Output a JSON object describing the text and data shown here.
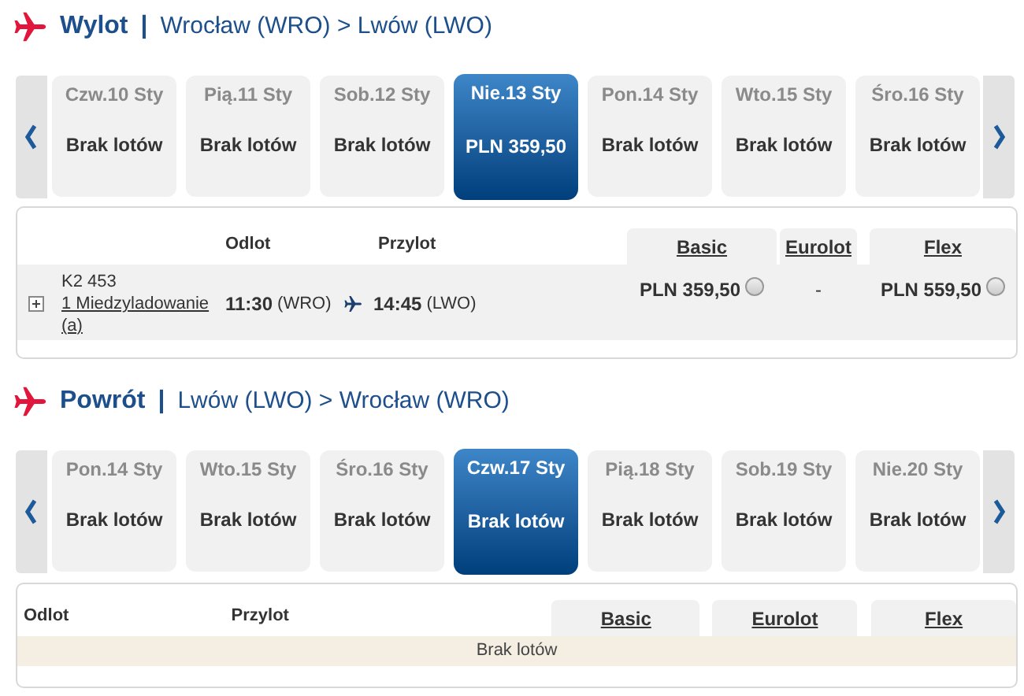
{
  "sections": [
    {
      "title": "Wylot",
      "separator": "|",
      "route": "Wrocław (WRO) > Lwów (LWO)",
      "dates": [
        {
          "day": "Czw.10 Sty",
          "fare": "Brak lotów",
          "selected": false
        },
        {
          "day": "Pią.11 Sty",
          "fare": "Brak lotów",
          "selected": false
        },
        {
          "day": "Sob.12 Sty",
          "fare": "Brak lotów",
          "selected": false
        },
        {
          "day": "Nie.13 Sty",
          "fare": "PLN 359,50",
          "selected": true
        },
        {
          "day": "Pon.14 Sty",
          "fare": "Brak lotów",
          "selected": false
        },
        {
          "day": "Wto.15 Sty",
          "fare": "Brak lotów",
          "selected": false
        },
        {
          "day": "Śro.16 Sty",
          "fare": "Brak lotów",
          "selected": false
        }
      ],
      "results": {
        "columns": [
          "Odlot",
          "Przylot"
        ],
        "fare_classes": [
          "Basic",
          "Eurolot",
          "Flex"
        ],
        "flights": [
          {
            "number": "K2 453",
            "stops": "1 Miedzyladowanie",
            "note": "(a)",
            "departure_time": "11:30",
            "departure_airport": "(WRO)",
            "arrival_time": "14:45",
            "arrival_airport": "(LWO)",
            "fares": [
              {
                "kind": "radio",
                "price": "PLN 359,50",
                "selected": false
              },
              {
                "kind": "none",
                "price": "-"
              },
              {
                "kind": "radio",
                "price": "PLN 559,50",
                "selected": false
              }
            ]
          }
        ]
      }
    },
    {
      "title": "Powrót",
      "separator": "|",
      "route": "Lwów (LWO) > Wrocław (WRO)",
      "dates": [
        {
          "day": "Pon.14 Sty",
          "fare": "Brak lotów",
          "selected": false
        },
        {
          "day": "Wto.15 Sty",
          "fare": "Brak lotów",
          "selected": false
        },
        {
          "day": "Śro.16 Sty",
          "fare": "Brak lotów",
          "selected": false
        },
        {
          "day": "Czw.17 Sty",
          "fare": "Brak lotów",
          "selected": true
        },
        {
          "day": "Pią.18 Sty",
          "fare": "Brak lotów",
          "selected": false
        },
        {
          "day": "Sob.19 Sty",
          "fare": "Brak lotów",
          "selected": false
        },
        {
          "day": "Nie.20 Sty",
          "fare": "Brak lotów",
          "selected": false
        }
      ],
      "results": {
        "columns": [
          "Odlot",
          "Przylot"
        ],
        "fare_classes": [
          "Basic",
          "Eurolot",
          "Flex"
        ],
        "message": "Brak lotów"
      }
    }
  ]
}
